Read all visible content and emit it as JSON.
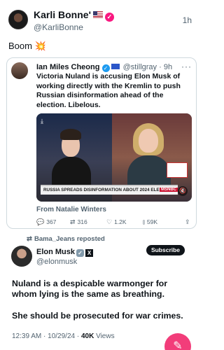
{
  "post": {
    "author_name": "Karli Bonne'",
    "handle": "@KarliBonne",
    "time": "1h",
    "text": "Boom",
    "emoji": "💥"
  },
  "quoted": {
    "author_name": "Ian Miles Cheong",
    "handle": "@stillgray",
    "time": "· 9h",
    "text": "Victoria Nuland is accusing Elon Musk of working directly with the Kremlin to push Russian disinformation ahead of the election. Libelous.",
    "media": {
      "chyron": "RUSSIA SPREADS DISINFORMATION ABOUT 2024 ELECTION",
      "network": "MSNBC"
    },
    "from": "From Natalie Winters",
    "replies": "367",
    "reposts": "316",
    "likes": "1.2K",
    "views": "59K"
  },
  "repost_line": "Bama_Jeans reposted",
  "embedded": {
    "author_name": "Elon Musk",
    "handle": "@elonmusk",
    "subscribe_label": "Subscribe",
    "text_1": "Nuland is a despicable warmonger for whom lying is the same as breathing.",
    "text_2": "She should be prosecuted for war crimes.",
    "timestamp": "12:39 AM · 10/29/24 · ",
    "views_count": "40K",
    "views_label": " Views"
  },
  "icons": {
    "compose": "compose-icon",
    "reply": "reply-icon",
    "repost": "repost-icon",
    "like": "heart-icon",
    "views": "views-icon",
    "share": "share-icon"
  },
  "colors": {
    "accent_blue": "#1d9bf0",
    "fab_pink": "#f23d7a",
    "muted": "#536471"
  }
}
